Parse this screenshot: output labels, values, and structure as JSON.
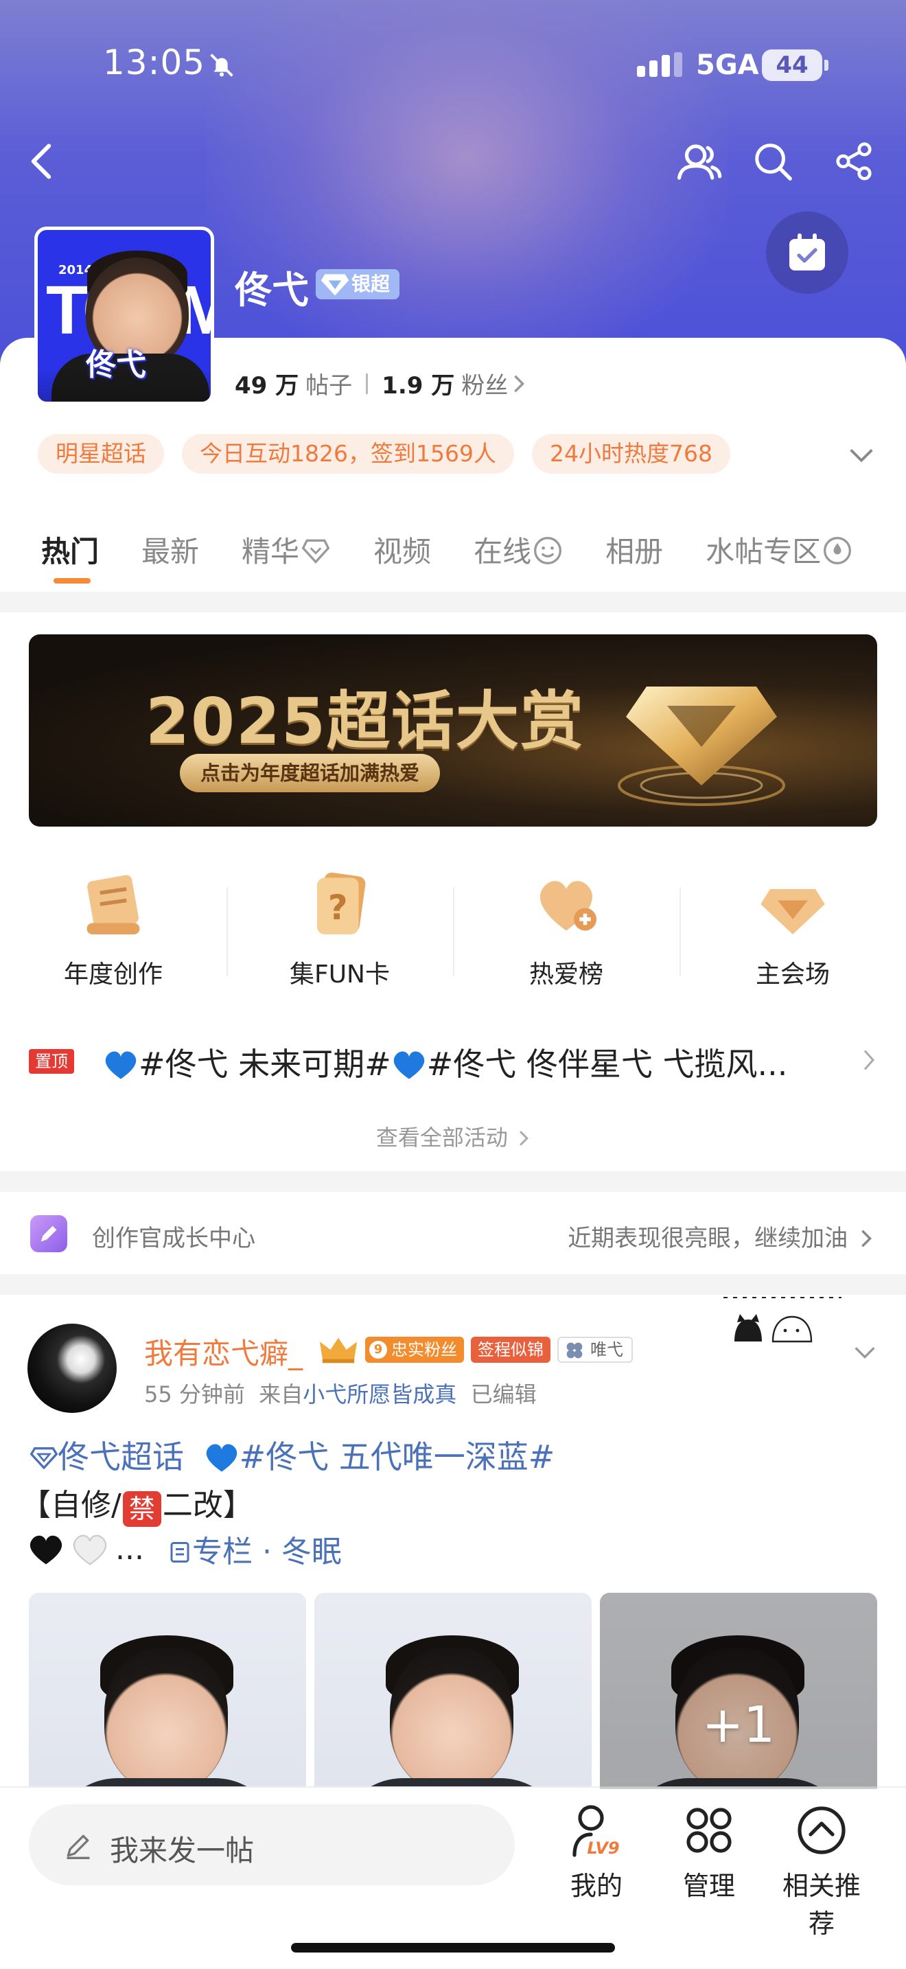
{
  "status_bar": {
    "time": "13:05",
    "network": "5GA",
    "battery": "44"
  },
  "header": {
    "name": "佟弋",
    "rank_badge": "银超",
    "avatar_sticker": "佟弋",
    "avatar_text": "TONM",
    "avatar_year": "2014"
  },
  "stats": {
    "posts_num": "49 万",
    "posts_label": "帖子",
    "fans_num": "1.9 万",
    "fans_label": "粉丝"
  },
  "tags": [
    "明星超话",
    "今日互动1826，签到1569人",
    "24小时热度768"
  ],
  "tabs": [
    "热门",
    "最新",
    "精华",
    "视频",
    "在线",
    "相册",
    "水帖专区"
  ],
  "banner": {
    "title": "2025超话大赏",
    "subtitle": "点击为年度超话加满热爱"
  },
  "quick_links": [
    "年度创作",
    "集FUN卡",
    "热爱榜",
    "主会场"
  ],
  "pinned": {
    "badge": "置顶",
    "text": "#佟弋 未来可期#",
    "text2": "#佟弋 佟伴星弋 弋揽风..."
  },
  "see_all": "查看全部活动",
  "creator": {
    "label": "创作官成长中心",
    "right": "近期表现很亮眼，继续加油"
  },
  "post": {
    "author": "我有恋弋癖_",
    "fan_level": "9",
    "fan_badge": "忠实粉丝",
    "name_badge": "签程似锦",
    "clover_badge": "唯弋",
    "time": "55 分钟前",
    "from_prefix": "来自",
    "source": "小弋所愿皆成真",
    "edited": "已编辑",
    "topic": "佟弋超话",
    "hashtag": "#佟弋 五代唯一深蓝#",
    "line2_a": "【自修/",
    "line2_ban": "禁",
    "line2_b": "二改】",
    "ellipsis": "...",
    "column_link": "专栏 · 冬眠",
    "more_photos": "+1"
  },
  "bottom_bar": {
    "compose_placeholder": "我来发一帖",
    "items": [
      "我的",
      "管理",
      "相关推荐"
    ],
    "level": "LV9"
  },
  "colors": {
    "accent_orange": "#f07a3c",
    "link_blue": "#4b71b8",
    "header_purple": "#5b5ed6",
    "pin_red": "#e43a33"
  }
}
